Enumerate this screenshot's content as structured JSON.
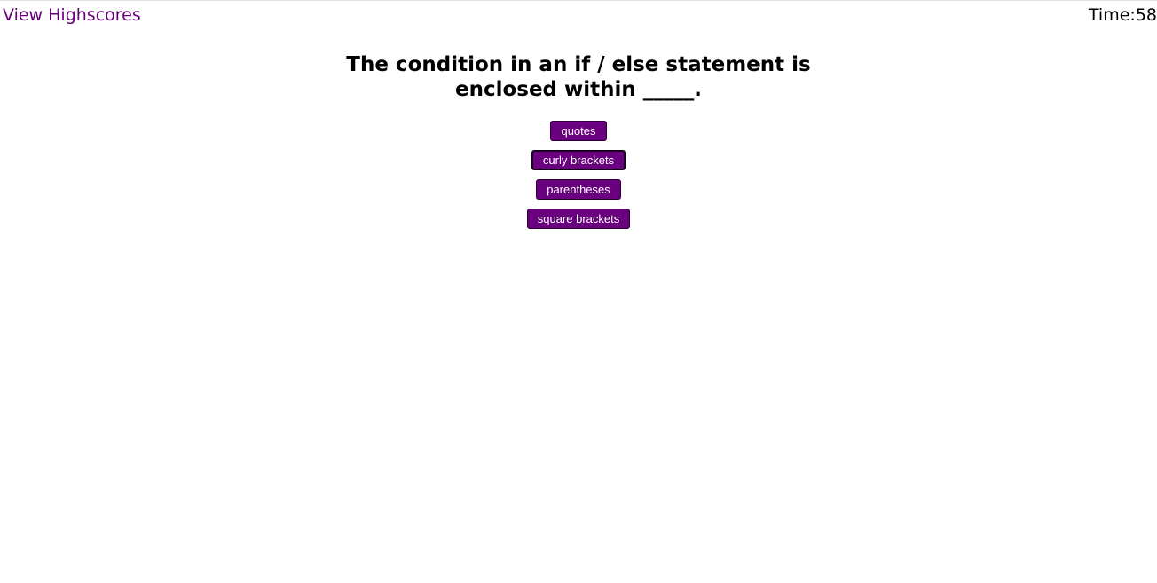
{
  "header": {
    "highscores_label": "View Highscores",
    "timer_label": "Time:",
    "timer_value": "58"
  },
  "quiz": {
    "question": "The condition in an if / else statement is enclosed within _____.",
    "choices": [
      {
        "label": "quotes"
      },
      {
        "label": "curly brackets"
      },
      {
        "label": "parentheses"
      },
      {
        "label": "square brackets"
      }
    ]
  },
  "colors": {
    "accent": "#6a0080",
    "link": "#660077"
  }
}
